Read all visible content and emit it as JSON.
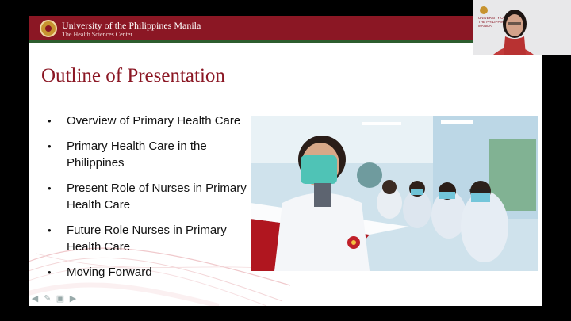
{
  "header": {
    "university": "University of the Philippines Manila",
    "subtitle": "The Health Sciences Center"
  },
  "slide": {
    "title": "Outline of Presentation",
    "bullets": [
      "Overview of Primary Health Care",
      "Primary Health Care in the Philippines",
      "Present Role of Nurses in Primary Health Care",
      "Future Role Nurses in Primary Health Care",
      "Moving Forward"
    ],
    "bullet_glyph": "•"
  },
  "webcam": {
    "caption": "UNIVERSITY OF THE PHILIPPINES MANILA"
  },
  "controls": {
    "icons": [
      "arrow-left-icon",
      "pen-icon",
      "slides-icon",
      "arrow-right-icon"
    ]
  },
  "colors": {
    "brand_maroon": "#8b1724",
    "brand_green": "#2d5d2e",
    "accent_gold": "#c7932f"
  }
}
